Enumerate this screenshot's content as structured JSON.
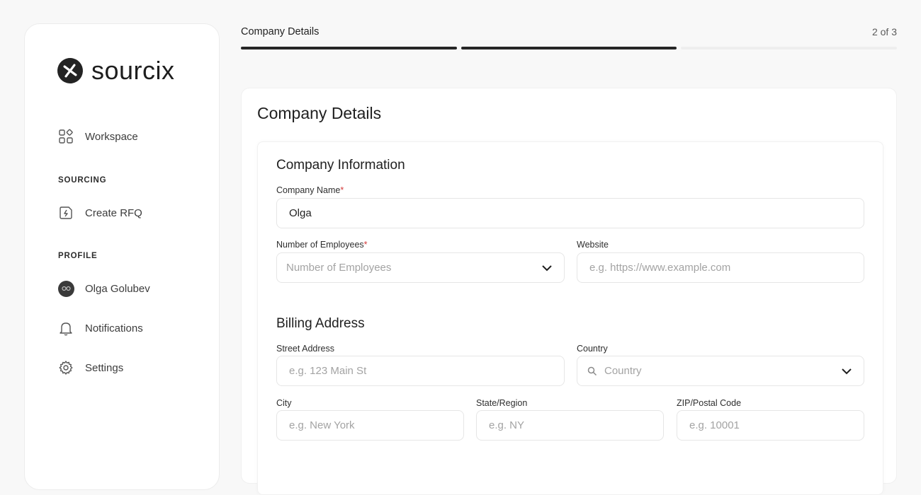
{
  "sidebar": {
    "brand": "sourcix",
    "workspace_label": "Workspace",
    "sourcing_section": "SOURCING",
    "create_rfq_label": "Create RFQ",
    "profile_section": "PROFILE",
    "user_name": "Olga Golubev",
    "notifications_label": "Notifications",
    "settings_label": "Settings"
  },
  "header": {
    "step_title": "Company Details",
    "step_count": "2 of 3",
    "progress": {
      "current_step": 2,
      "total_steps": 3
    }
  },
  "card": {
    "title": "Company Details"
  },
  "company_info": {
    "title": "Company Information",
    "company_name_label": "Company Name",
    "company_name_value": "Olga",
    "employees_label": "Number of Employees",
    "employees_placeholder": "Number of Employees",
    "website_label": "Website",
    "website_placeholder": "e.g. https://www.example.com"
  },
  "billing": {
    "title": "Billing Address",
    "street_label": "Street Address",
    "street_placeholder": "e.g. 123 Main St",
    "country_label": "Country",
    "country_placeholder": "Country",
    "city_label": "City",
    "city_placeholder": "e.g. New York",
    "state_label": "State/Region",
    "state_placeholder": "e.g. NY",
    "zip_label": "ZIP/Postal Code",
    "zip_placeholder": "e.g. 10001"
  },
  "required_marker": "*",
  "colors": {
    "background": "#f8f8f8",
    "progress_done": "#262626",
    "progress_todo": "#eeeeee",
    "required": "#d33a3a",
    "placeholder": "#a3a3a3"
  }
}
